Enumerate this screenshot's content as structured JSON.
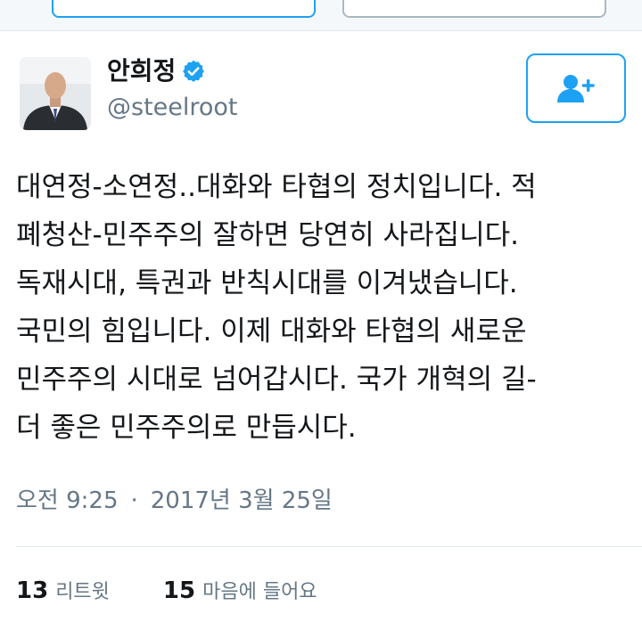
{
  "profile": {
    "display_name": "안희정",
    "handle": "@steelroot",
    "verified_icon": "verified-badge-icon",
    "follow_icon": "add-user-icon"
  },
  "tweet": {
    "lines": [
      "대연정-소연정..대화와 타협의 정치입니다. 적",
      "폐청산-민주주의 잘하면 당연히 사라집니다.",
      "독재시대, 특권과 반칙시대를 이겨냈습니다.",
      "국민의 힘입니다. 이제 대화와 타협의 새로운",
      "민주주의 시대로 넘어갑시다. 국가 개혁의 길-",
      "더 좋은 민주주의로 만듭시다."
    ]
  },
  "meta": {
    "time": "오전 9:25",
    "separator": "·",
    "date": "2017년 3월 25일"
  },
  "stats": {
    "retweets_count": "13",
    "retweets_label": "리트윗",
    "likes_count": "15",
    "likes_label": "마음에 들어요"
  },
  "colors": {
    "accent": "#1da1f2",
    "text": "#14171a",
    "secondary_text": "#657786",
    "divider": "#e1e8ed"
  }
}
